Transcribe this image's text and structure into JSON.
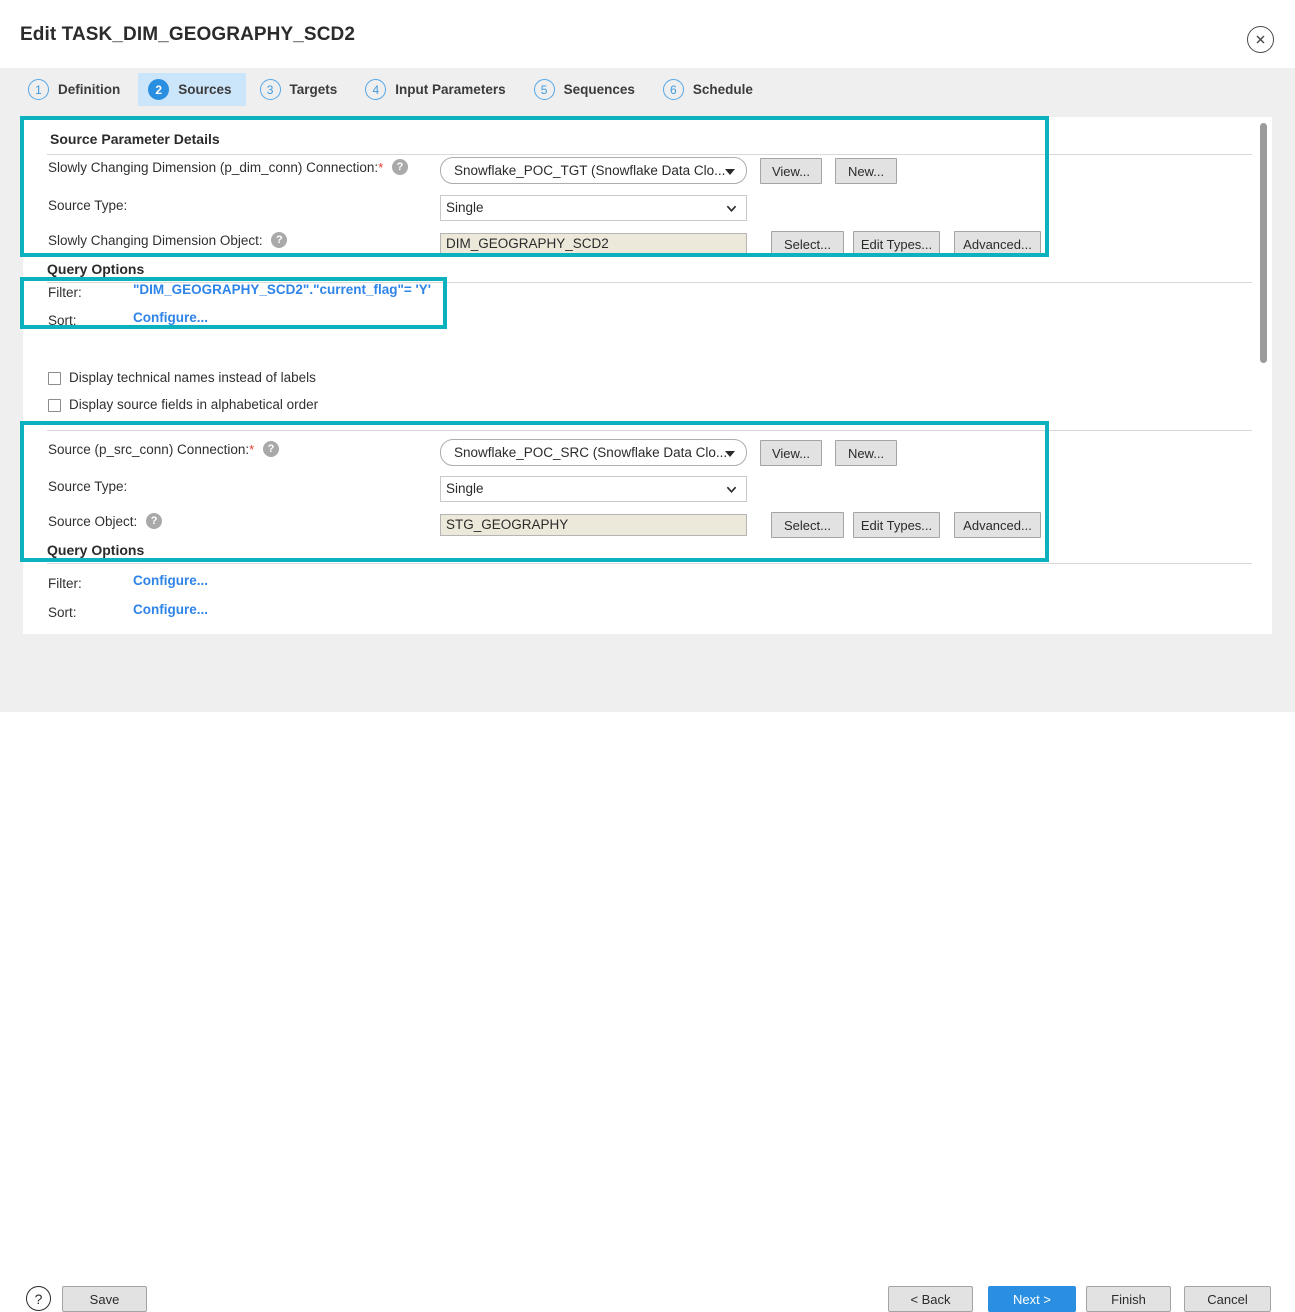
{
  "header": {
    "title": "Edit TASK_DIM_GEOGRAPHY_SCD2",
    "close_label": "close-icon"
  },
  "tabs": [
    {
      "num": "1",
      "label": "Definition",
      "active": false
    },
    {
      "num": "2",
      "label": "Sources",
      "active": true
    },
    {
      "num": "3",
      "label": "Targets",
      "active": false
    },
    {
      "num": "4",
      "label": "Input Parameters",
      "active": false
    },
    {
      "num": "5",
      "label": "Sequences",
      "active": false
    },
    {
      "num": "6",
      "label": "Schedule",
      "active": false
    }
  ],
  "dim_section": {
    "title": "Source Parameter Details",
    "connection_label": "Slowly Changing Dimension (p_dim_conn) Connection:",
    "connection_required": "*",
    "connection_value": "Snowflake_POC_TGT (Snowflake Data Clo...",
    "view_button": "View...",
    "new_button": "New...",
    "source_type_label": "Source Type:",
    "source_type_value": "Single",
    "object_label": "Slowly Changing Dimension Object:",
    "object_value": "DIM_GEOGRAPHY_SCD2",
    "select_button": "Select...",
    "edit_types_button": "Edit Types...",
    "advanced_button": "Advanced...",
    "query_options_title": "Query Options",
    "filter_label": "Filter:",
    "filter_value": "\"DIM_GEOGRAPHY_SCD2\".\"current_flag\"= 'Y'",
    "sort_label": "Sort:",
    "sort_value": "Configure..."
  },
  "checkboxes": [
    {
      "label": "Display technical names instead of labels",
      "checked": false
    },
    {
      "label": "Display source fields in alphabetical order",
      "checked": false
    }
  ],
  "src_section": {
    "connection_label": "Source (p_src_conn) Connection:",
    "connection_required": "*",
    "connection_value": "Snowflake_POC_SRC (Snowflake Data Clo...",
    "view_button": "View...",
    "new_button": "New...",
    "source_type_label": "Source Type:",
    "source_type_value": "Single",
    "object_label": "Source Object:",
    "object_value": "STG_GEOGRAPHY",
    "select_button": "Select...",
    "edit_types_button": "Edit Types...",
    "advanced_button": "Advanced...",
    "query_options_title": "Query Options",
    "filter_label": "Filter:",
    "filter_value": "Configure...",
    "sort_label": "Sort:",
    "sort_value": "Configure..."
  },
  "footer": {
    "help_label": "?",
    "save_label": "Save",
    "back_label": "< Back",
    "next_label": "Next >",
    "finish_label": "Finish",
    "cancel_label": "Cancel"
  },
  "colors": {
    "highlight": "#0bb2bd",
    "accent_blue": "#2a8fe0",
    "link": "#2f84e8",
    "required": "#e03b2f",
    "readonly_field": "#ece8da"
  }
}
